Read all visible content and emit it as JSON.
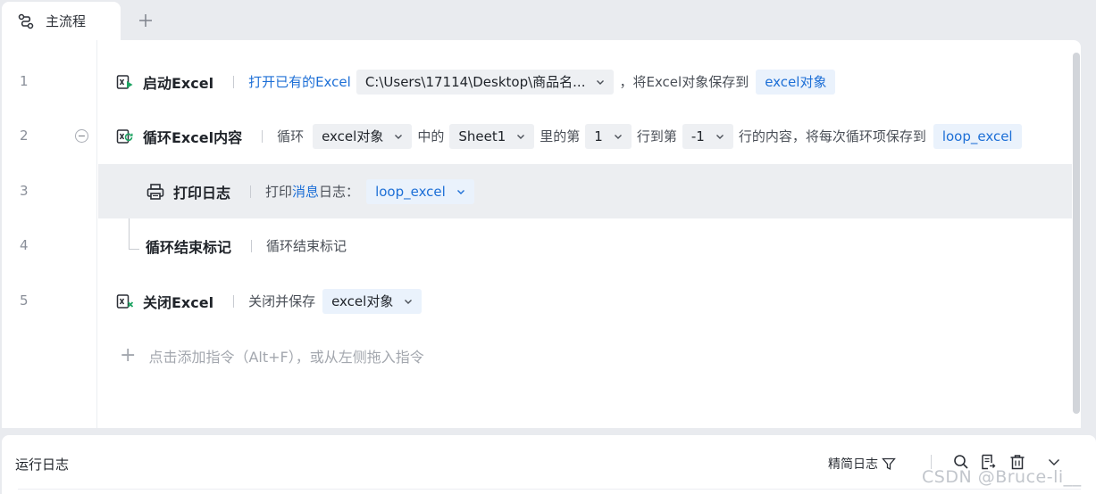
{
  "tabs": [
    {
      "label": "主流程",
      "icon": "flow-icon",
      "active": true
    }
  ],
  "add_tab_icon": "plus-icon",
  "line_numbers": [
    "1",
    "2",
    "3",
    "4",
    "5"
  ],
  "rows": {
    "r1": {
      "title": "启动Excel",
      "link": "打开已有的Excel",
      "path_value": "C:\\Users\\17114\\Desktop\\商品名...",
      "suffix": "，将Excel对象保存到",
      "output_var": "excel对象"
    },
    "r2": {
      "title": "循环Excel内容",
      "t_loop": "循环",
      "obj": "excel对象",
      "t_in": "中的",
      "sheet": "Sheet1",
      "t_from": "里的第",
      "start": "1",
      "t_to": "行到第",
      "end": "-1",
      "t_save": "行的内容，将每次循环项保存到",
      "loop_var": "loop_excel"
    },
    "r3": {
      "title": "打印日志",
      "t_print": "打印",
      "link": "消息",
      "t_log": "日志：",
      "value": "loop_excel"
    },
    "r4": {
      "title": "循环结束标记",
      "desc": "循环结束标记"
    },
    "r5": {
      "title": "关闭Excel",
      "desc": "关闭并保存",
      "obj": "excel对象"
    }
  },
  "add_instruction": "点击添加指令（Alt+F），或从左侧拖入指令",
  "log_panel": {
    "title": "运行日志",
    "filter_label": "精简日志"
  },
  "watermark": "CSDN @Bruce-li__",
  "colors": {
    "accent": "#1d6fd6",
    "chip_bg": "#eaf2fc",
    "excel_green": "#1fa463",
    "excel_red": "#e3473b"
  }
}
